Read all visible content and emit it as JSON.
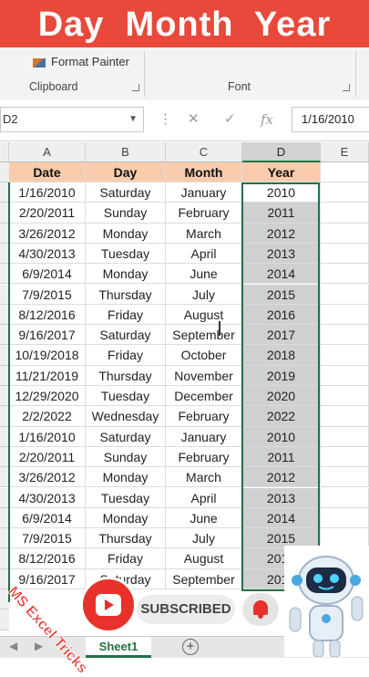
{
  "banner": {
    "title": "Day  Month  Year",
    "color": "#e8493a"
  },
  "ribbon": {
    "format_painter": "Format Painter",
    "groups": [
      "Clipboard",
      "Font"
    ]
  },
  "formula_bar": {
    "name_box": "D2",
    "formula": "1/16/2010"
  },
  "columns": [
    "A",
    "B",
    "C",
    "D",
    "E"
  ],
  "selected_column": "D",
  "headers": {
    "date": "Date",
    "day": "Day",
    "month": "Month",
    "year": "Year"
  },
  "rows": [
    {
      "date": "1/16/2010",
      "day": "Saturday",
      "month": "January",
      "year": "2010"
    },
    {
      "date": "2/20/2011",
      "day": "Sunday",
      "month": "February",
      "year": "2011"
    },
    {
      "date": "3/26/2012",
      "day": "Monday",
      "month": "March",
      "year": "2012"
    },
    {
      "date": "4/30/2013",
      "day": "Tuesday",
      "month": "April",
      "year": "2013"
    },
    {
      "date": "6/9/2014",
      "day": "Monday",
      "month": "June",
      "year": "2014"
    },
    {
      "date": "7/9/2015",
      "day": "Thursday",
      "month": "July",
      "year": "2015"
    },
    {
      "date": "8/12/2016",
      "day": "Friday",
      "month": "August",
      "year": "2016"
    },
    {
      "date": "9/16/2017",
      "day": "Saturday",
      "month": "September",
      "year": "2017"
    },
    {
      "date": "10/19/2018",
      "day": "Friday",
      "month": "October",
      "year": "2018"
    },
    {
      "date": "11/21/2019",
      "day": "Thursday",
      "month": "November",
      "year": "2019"
    },
    {
      "date": "12/29/2020",
      "day": "Tuesday",
      "month": "December",
      "year": "2020"
    },
    {
      "date": "2/2/2022",
      "day": "Wednesday",
      "month": "February",
      "year": "2022"
    },
    {
      "date": "1/16/2010",
      "day": "Saturday",
      "month": "January",
      "year": "2010"
    },
    {
      "date": "2/20/2011",
      "day": "Sunday",
      "month": "February",
      "year": "2011"
    },
    {
      "date": "3/26/2012",
      "day": "Monday",
      "month": "March",
      "year": "2012"
    },
    {
      "date": "4/30/2013",
      "day": "Tuesday",
      "month": "April",
      "year": "2013"
    },
    {
      "date": "6/9/2014",
      "day": "Monday",
      "month": "June",
      "year": "2014"
    },
    {
      "date": "7/9/2015",
      "day": "Thursday",
      "month": "July",
      "year": "2015"
    },
    {
      "date": "8/12/2016",
      "day": "Friday",
      "month": "August",
      "year": "2016"
    },
    {
      "date": "9/16/2017",
      "day": "Saturday",
      "month": "September",
      "year": "2017"
    }
  ],
  "sheet_tab": "Sheet1",
  "overlay": {
    "channel_name": "MS Excel Tricks",
    "subscribe_label": "SUBSCRIBED"
  },
  "icons": [
    "format-painter-icon",
    "cancel-icon",
    "enter-icon",
    "fx-icon",
    "add-sheet-icon",
    "bell-icon",
    "robot-icon"
  ],
  "colors": {
    "header_fill": "#f8cbad",
    "selection": "#217346",
    "selected_fill": "#d0d0d0"
  }
}
